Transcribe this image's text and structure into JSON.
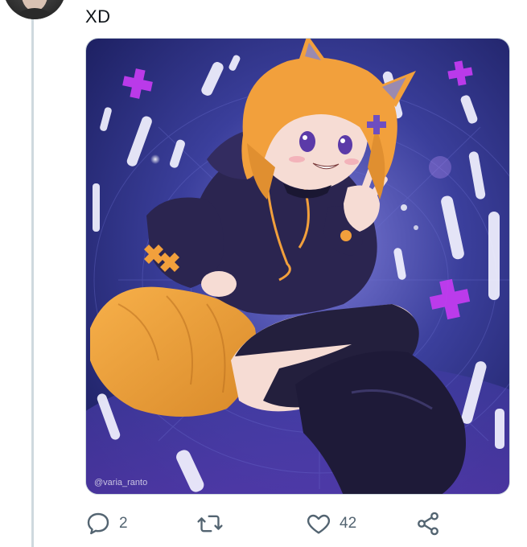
{
  "tweet": {
    "text": "XD"
  },
  "media": {
    "watermark": "@varia_ranto"
  },
  "actions": {
    "reply": {
      "icon": "reply-icon",
      "count": "2"
    },
    "retweet": {
      "icon": "retweet-icon",
      "count": ""
    },
    "like": {
      "icon": "heart-icon",
      "count": "42"
    },
    "share": {
      "icon": "share-icon"
    }
  },
  "colors": {
    "icon_gray": "#536471",
    "text_dark": "#0f1419",
    "thread_line": "#cfd9de",
    "accent_purple": "#c23cf0",
    "hair_orange": "#f2a03c",
    "hoodie_navy": "#2b2550"
  }
}
